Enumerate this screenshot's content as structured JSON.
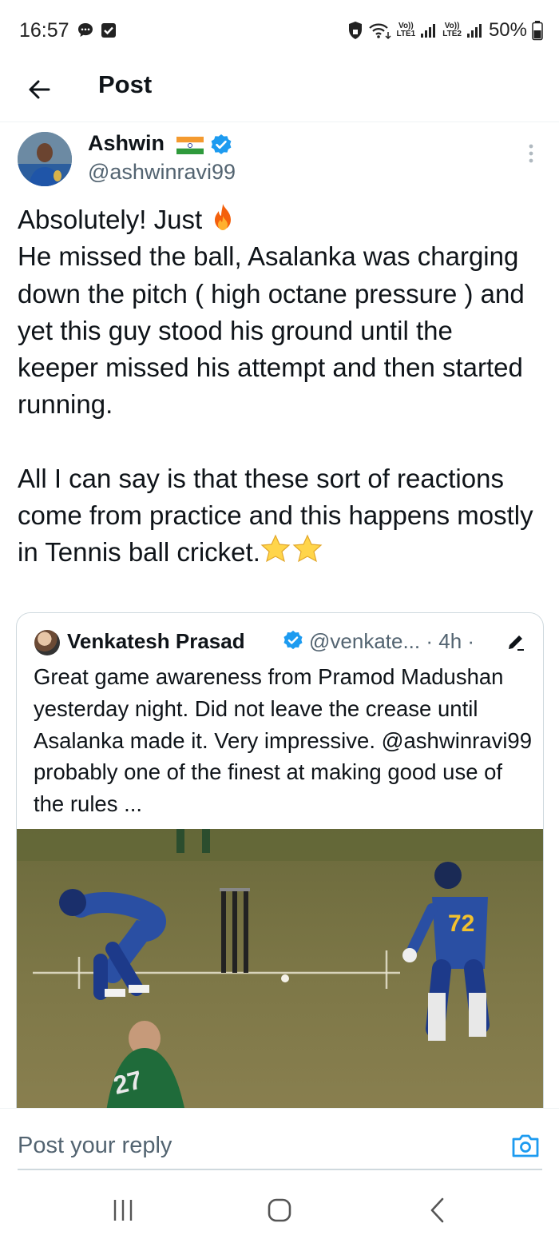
{
  "status_bar": {
    "time": "16:57",
    "sim1_label": "Vo))\nLTE1",
    "sim2_label": "Vo))\nLTE2",
    "battery": "50%"
  },
  "header": {
    "title": "Post"
  },
  "tweet": {
    "author_name": "Ashwin",
    "author_handle": "@ashwinravi99",
    "line1": "Absolutely! Just",
    "para1": "He missed the ball, Asalanka was charging down the pitch ( high octane pressure ) and yet this guy stood his ground until the keeper missed his attempt and then started running.",
    "para2": "All I can say is that these sort of reactions come from practice and this happens mostly in Tennis ball cricket."
  },
  "quote": {
    "author_name": "Venkatesh Prasad",
    "author_handle": "@venkate...",
    "meta": "· 4h ·",
    "text": "Great game awareness from Pramod Madushan yesterday night. Did not leave the crease until Asalanka made it. Very impressive. @ashwinravi99 probably one of the finest at making good use of  the rules ...",
    "jersey_left": "72",
    "jersey_front": "27"
  },
  "reply": {
    "placeholder": "Post your reply"
  },
  "icons": {
    "back": "arrow-left-icon",
    "more": "more-vertical-icon",
    "verified": "verified-badge-icon",
    "camera": "camera-icon",
    "edit": "edit-pencil-icon"
  },
  "colors": {
    "verified": "#1d9bf0",
    "text": "#0f1419",
    "muted": "#536471",
    "border": "#cfd9de"
  }
}
